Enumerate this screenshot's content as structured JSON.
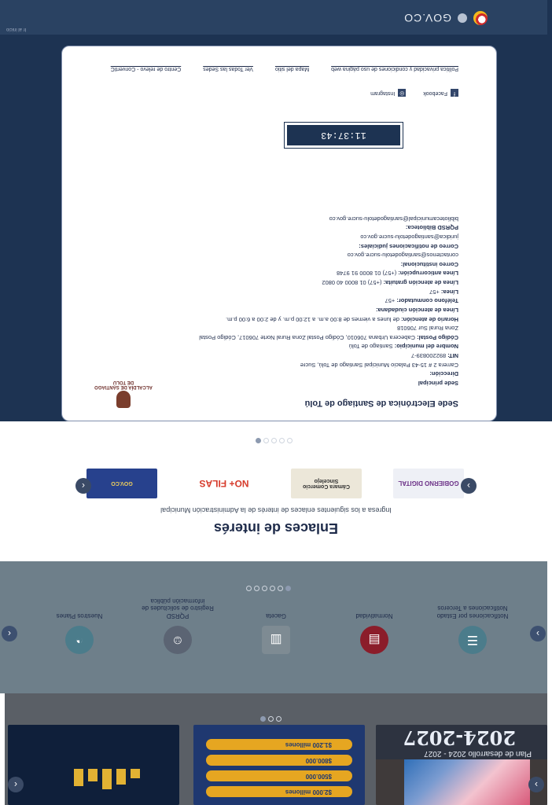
{
  "banner": {
    "card1_subtitle": "Plan de desarrollo 2024 - 2027",
    "card1_title": "2024-2027",
    "card2_rows": [
      "$2.000 millones",
      "$500.000",
      "$800.000",
      "$1.200 millones"
    ],
    "nav_prev": "‹",
    "nav_next": "›"
  },
  "quick_links": {
    "items": [
      {
        "label": "Nuestros Planes",
        "icon": "gauge-icon"
      },
      {
        "label": "Registro de solicitudes de información pública",
        "icon": "face-icon"
      },
      {
        "label": "Gaceta",
        "icon": "newspaper-icon"
      },
      {
        "label": "PQRSD",
        "icon": "document-icon"
      },
      {
        "label": "Normatividad",
        "icon": "checklist-icon"
      },
      {
        "label": "Notificaciones por Estado Notificaciones a Terceros",
        "icon": "checklist-icon"
      }
    ]
  },
  "enlaces": {
    "title": "Enlaces de interés",
    "subtitle": "Ingresa a los siguientes enlaces de interés de la Administración Municipal",
    "logos": [
      "GOBIERNO DIGITAL",
      "Cámara Comercio Sincelejo",
      "NO+ FILAS",
      "GOV.CO"
    ]
  },
  "footer": {
    "heading": "Sede Electrónica de Santiago de Tolú",
    "seal": "ALCALDÍA DE SANTIAGO DE TOLÚ",
    "lines": [
      {
        "b": "Sede principal",
        "t": ""
      },
      {
        "b": "Dirección:",
        "t": ""
      },
      {
        "b": "",
        "t": "Carrera 2 # 15-43 Palacio Municipal Santiago de Tolú, Sucre"
      },
      {
        "b": "NIT:",
        "t": "892200839-7"
      },
      {
        "b": "Nombre del municipio:",
        "t": "Santiago de Tolú"
      },
      {
        "b": "Código Postal:",
        "t": "Cabecera Urbana 706010, Código Postal Zona Rural Norte 706017, Código Postal Zona Rural Sur 706018"
      },
      {
        "b": "Horario de atención:",
        "t": "de lunes a viernes de 8:00 a.m. a 12:00 p.m. y de 2:00 a 6:00 p.m."
      },
      {
        "b": "Línea de atención ciudadana:",
        "t": ""
      },
      {
        "b": "Teléfono conmutador:",
        "t": "+57"
      },
      {
        "b": "Línea:",
        "t": "+57"
      },
      {
        "b": "Línea de atención gratuita:",
        "t": "(+57) 01 8000 40 0802"
      },
      {
        "b": "Línea anticorrupción:",
        "t": "(+57) 01 8000 91 9748"
      },
      {
        "b": "Correo institucional:",
        "t": ""
      },
      {
        "b": "",
        "t": "contactenos@santiagodetolu-sucre.gov.co"
      },
      {
        "b": "Correo de notificaciones judiciales:",
        "t": ""
      },
      {
        "b": "",
        "t": "juridica@santiagodetolu-sucre.gov.co"
      },
      {
        "b": "PQRSD Biblioteca:",
        "t": ""
      },
      {
        "b": "",
        "t": "bibliotecamunicipal@santiagodetolu-sucre.gov.co"
      }
    ],
    "clock": "11:37:43",
    "social": [
      "Facebook",
      "Instagram"
    ],
    "links": [
      "Política privacidad y condiciones de uso página web",
      "Mapa del sitio",
      "Ver Todas las Sedes",
      "Centro de relevo - ConvertIC"
    ]
  },
  "govbar": {
    "brand": "GOV.CO",
    "corner": "Ir al inicio"
  },
  "colors": {
    "navy": "#1d3352",
    "band": "#6e7f8a",
    "gray": "#5a5f66"
  }
}
